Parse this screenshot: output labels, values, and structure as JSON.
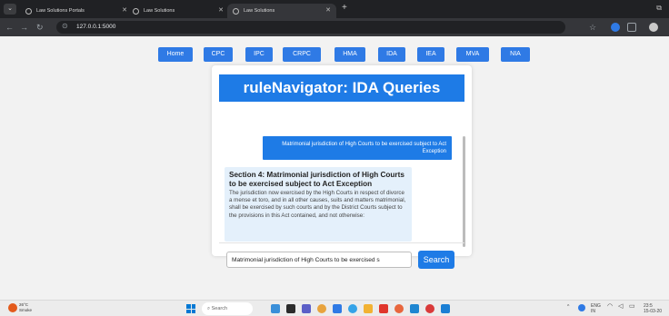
{
  "browser": {
    "tabs": [
      {
        "label": "Law Solutions Portals",
        "active": false
      },
      {
        "label": "Law Solutions",
        "active": false
      },
      {
        "label": "Law Solutions",
        "active": true
      }
    ],
    "new_tab": "+",
    "url": "127.0.0.1:5000"
  },
  "nav": {
    "items": [
      "Home",
      "CPC",
      "IPC",
      "CRPC",
      "HMA",
      "IDA",
      "IEA",
      "MVA",
      "NIA"
    ]
  },
  "app": {
    "title": "ruleNavigator: IDA Queries"
  },
  "chat": {
    "user_message": "Matrimonial jurisdiction of High Courts to be exercised subject to Act Exception",
    "bot_title": "Section 4: Matrimonial jurisdiction of High Courts to be exercised subject to Act Exception",
    "bot_body": "The jurisdiction now exercised by the High Courts in respect of divorce a mense et toro, and in all other causes, suits and matters matrimonial, shall be exercised by such courts and by the District Courts subject to the provisions in this Act contained, and not otherwise:"
  },
  "search": {
    "value": "Matrimonial jurisdiction of High Courts to be exercised s",
    "button_label": "Search"
  },
  "taskbar": {
    "weather_temp": "26°C",
    "weather_desc": "Smoke",
    "search_placeholder": "Search",
    "lang": "ENG",
    "region": "IN",
    "time": "23:5",
    "date": "15-03-20"
  },
  "colors": {
    "accent": "#1e7be6",
    "nav_button": "#2f7ae5",
    "bot_bubble": "#e4f0fb",
    "chrome_dark": "#202124"
  }
}
